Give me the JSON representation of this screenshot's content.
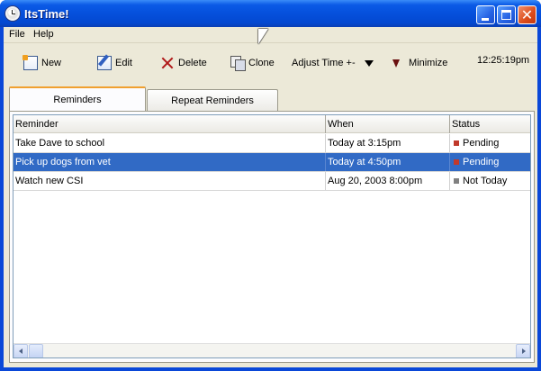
{
  "window": {
    "title": "ItsTime!",
    "title_bar_color": "#0550dc"
  },
  "menubar": {
    "items": [
      "File",
      "Help"
    ]
  },
  "toolbar": {
    "new_label": "New",
    "edit_label": "Edit",
    "delete_label": "Delete",
    "clone_label": "Clone",
    "adjust_label": "Adjust Time +-",
    "minimize_label": "Minimize",
    "clock": "12:25:19pm"
  },
  "tabs": [
    {
      "label": "Reminders",
      "active": true
    },
    {
      "label": "Repeat Reminders",
      "active": false
    }
  ],
  "table": {
    "columns": [
      "Reminder",
      "When",
      "Status"
    ],
    "rows": [
      {
        "reminder": "Take Dave to school",
        "when": "Today at 3:15pm",
        "status": "Pending",
        "status_color": "#c0392b",
        "selected": false
      },
      {
        "reminder": "Pick up dogs from vet",
        "when": "Today at 4:50pm",
        "status": "Pending",
        "status_color": "#c0392b",
        "selected": true
      },
      {
        "reminder": "Watch new CSI",
        "when": "Aug 20, 2003 8:00pm",
        "status": "Not Today",
        "status_color": "#808080",
        "selected": false
      }
    ]
  },
  "colors": {
    "selection": "#316ac5",
    "face": "#ece9d8",
    "tab_accent": "#f0a030"
  }
}
